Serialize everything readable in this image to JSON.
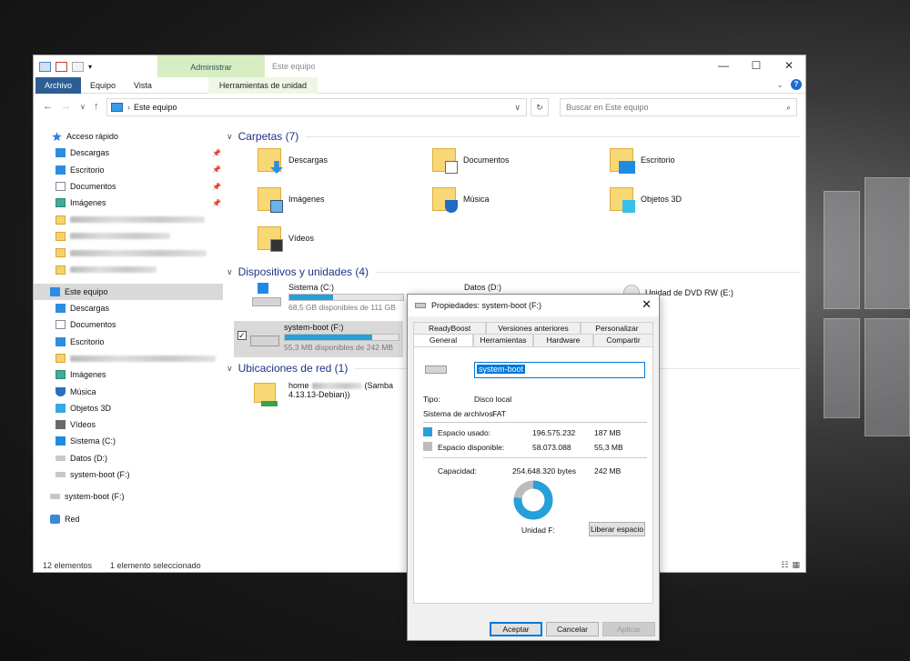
{
  "explorer": {
    "context_tab": "Administrar",
    "window_title": "Este equipo",
    "tabs": [
      "Archivo",
      "Equipo",
      "Vista",
      "Herramientas de unidad"
    ],
    "address": "Este equipo",
    "search_placeholder": "Buscar en Este equipo",
    "win_controls": [
      "—",
      "☐",
      "✕"
    ],
    "sidebar": {
      "quick_access": "Acceso rápido",
      "quick_items": [
        "Descargas",
        "Escritorio",
        "Documentos",
        "Imágenes"
      ],
      "this_pc": "Este equipo",
      "pc_items": [
        "Descargas",
        "Documentos",
        "Escritorio",
        "Imágenes",
        "Música",
        "Objetos 3D",
        "Vídeos",
        "Sistema (C:)",
        "Datos (D:)",
        "system-boot (F:)"
      ],
      "removable": "system-boot (F:)",
      "network": "Red"
    },
    "folders_header": "Carpetas (7)",
    "folders": [
      "Descargas",
      "Documentos",
      "Escritorio",
      "Imágenes",
      "Música",
      "Objetos 3D",
      "Vídeos"
    ],
    "devices_header": "Dispositivos y unidades (4)",
    "drives": [
      {
        "name": "Sistema (C:)",
        "free": "68,5 GB disponibles de 111 GB",
        "used_fraction": 0.38
      },
      {
        "name": "system-boot (F:)",
        "free": "55,3 MB disponibles de 242 MB",
        "used_fraction": 0.77
      },
      {
        "name": "Datos (D:)"
      },
      {
        "name": "Unidad de DVD RW (E:)"
      }
    ],
    "network_header": "Ubicaciones de red (1)",
    "network_item": {
      "name_start": "home",
      "name_end": "(Samba",
      "line2": "4.13.13-Debian))"
    },
    "status": {
      "count": "12 elementos",
      "selected": "1 elemento seleccionado"
    }
  },
  "dialog": {
    "title": "Propiedades: system-boot (F:)",
    "tabs_row1": [
      "ReadyBoost",
      "Versiones anteriores",
      "Personalizar"
    ],
    "tabs_row2": [
      "General",
      "Herramientas",
      "Hardware",
      "Compartir"
    ],
    "name_value": "system-boot",
    "type_label": "Tipo:",
    "type_value": "Disco local",
    "fs_label": "Sistema de archivos:",
    "fs_value": "FAT",
    "used_label": "Espacio usado:",
    "used_bytes": "196.575.232",
    "used_size": "187 MB",
    "free_label": "Espacio disponible:",
    "free_bytes": "58.073.088",
    "free_size": "55,3 MB",
    "capacity_label": "Capacidad:",
    "capacity_bytes": "254.648.320 bytes",
    "capacity_size": "242 MB",
    "drive_label": "Unidad F:",
    "free_space_button": "Liberar espacio",
    "buttons": {
      "ok": "Aceptar",
      "cancel": "Cancelar",
      "apply": "Aplicar"
    },
    "used_fraction": 0.772,
    "colors": {
      "used": "#26a0da",
      "free": "#bcbcbc"
    }
  }
}
